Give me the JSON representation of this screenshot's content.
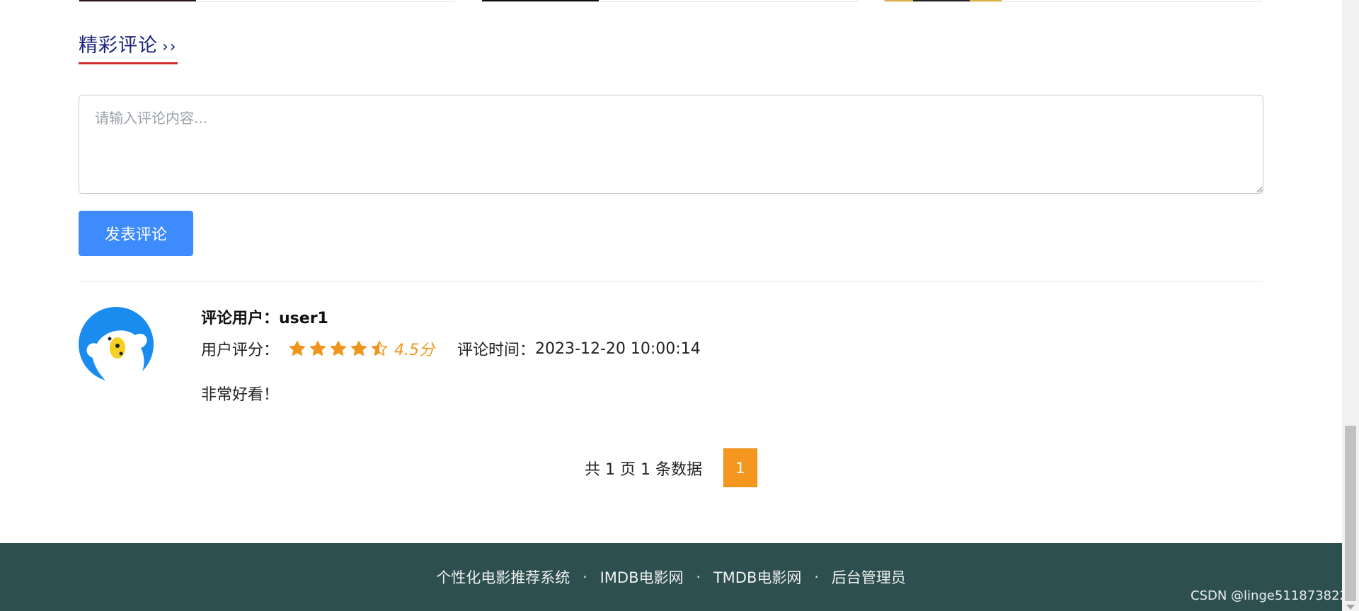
{
  "section": {
    "title": "精彩评论",
    "arrows": "››"
  },
  "comment_form": {
    "placeholder": "请输入评论内容...",
    "submit_label": "发表评论"
  },
  "comments": [
    {
      "user_label": "评论用户：",
      "user_name": "user1",
      "rating_label": "用户评分：",
      "rating": 4.5,
      "rating_max": 5,
      "rating_text": "4.5分",
      "time_label": "评论时间：",
      "time": "2023-12-20 10:00:14",
      "content": "非常好看！"
    }
  ],
  "pagination": {
    "info": "共 1 页 1 条数据",
    "current_page": "1"
  },
  "footer": {
    "links": [
      "个性化电影推荐系统",
      "IMDB电影网",
      "TMDB电影网",
      "后台管理员"
    ],
    "separator": "·"
  },
  "watermark": "CSDN @linge511873822",
  "colors": {
    "primary_button": "#3d8bfd",
    "title_text": "#1a237e",
    "title_underline": "#d32f2f",
    "star": "#f0961e",
    "page_active": "#f5961e",
    "footer_bg": "#2e4f4f"
  }
}
